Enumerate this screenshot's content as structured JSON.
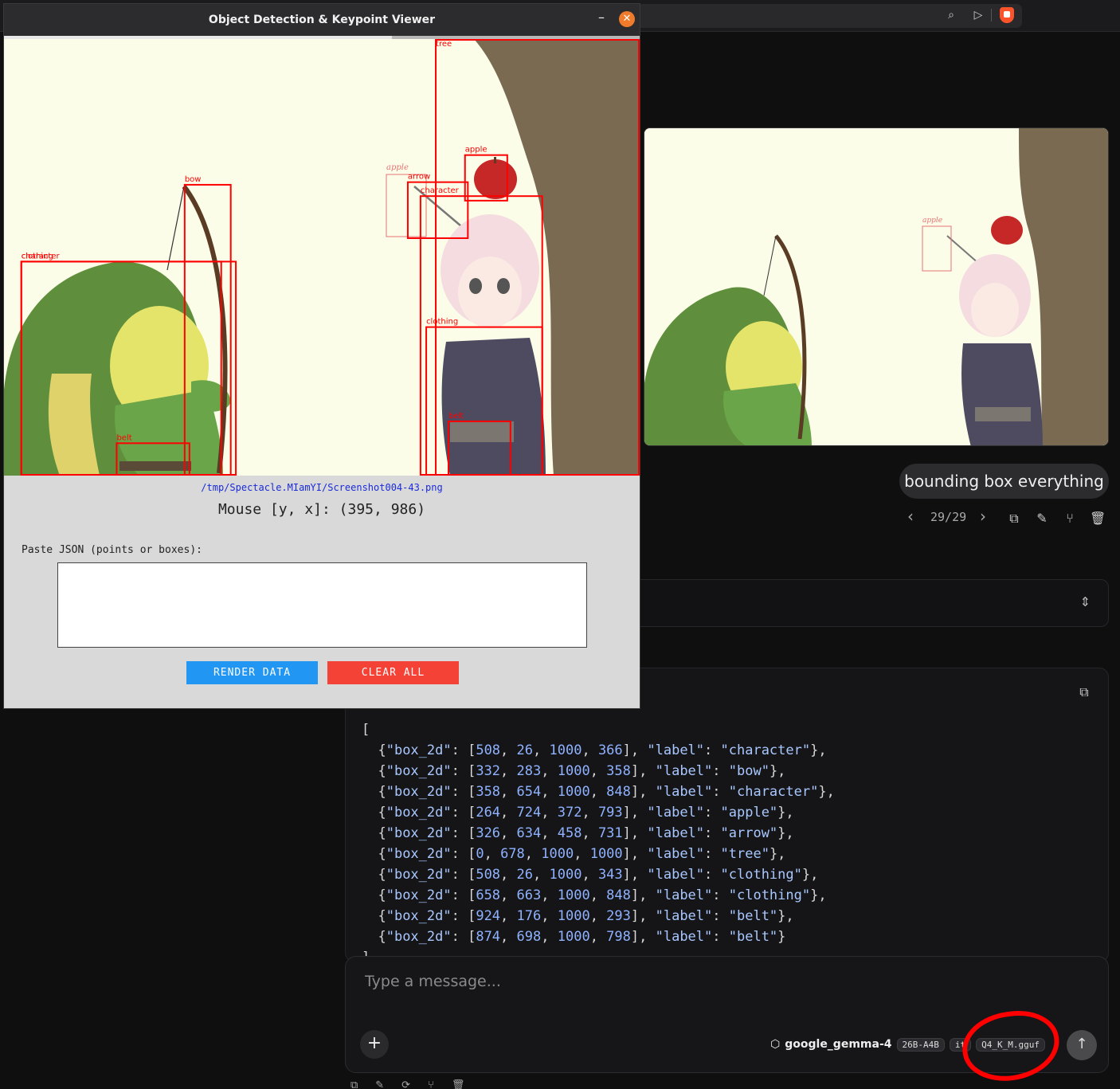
{
  "viewer": {
    "title": "Object Detection & Keypoint Viewer",
    "min_glyph": "–",
    "close_glyph": "✕",
    "progress": 0.61,
    "file_path": "/tmp/Spectacle.MIamYI/Screenshot004-43.png",
    "mouse_readout": "Mouse [y, x]: (395, 986)",
    "paste_label": "Paste JSON (points or boxes):",
    "json_input_value": "",
    "render_button": "RENDER DATA",
    "clear_button": "CLEAR ALL",
    "box_color": "#ff0000",
    "detections": [
      {
        "box_2d": [
          508,
          26,
          1000,
          366
        ],
        "label": "character"
      },
      {
        "box_2d": [
          332,
          283,
          1000,
          358
        ],
        "label": "bow"
      },
      {
        "box_2d": [
          358,
          654,
          1000,
          848
        ],
        "label": "character"
      },
      {
        "box_2d": [
          264,
          724,
          372,
          793
        ],
        "label": "apple"
      },
      {
        "box_2d": [
          326,
          634,
          458,
          731
        ],
        "label": "arrow"
      },
      {
        "box_2d": [
          0,
          678,
          1000,
          1000
        ],
        "label": "tree"
      },
      {
        "box_2d": [
          508,
          26,
          1000,
          343
        ],
        "label": "clothing"
      },
      {
        "box_2d": [
          658,
          663,
          1000,
          848
        ],
        "label": "clothing"
      },
      {
        "box_2d": [
          924,
          176,
          1000,
          293
        ],
        "label": "belt"
      },
      {
        "box_2d": [
          874,
          698,
          1000,
          798
        ],
        "label": "belt"
      }
    ],
    "faint_label": "apple"
  },
  "chat": {
    "preview_label": "apple",
    "user_message": "bounding box everything",
    "message_counter": "29/29",
    "nav_prev": "‹",
    "nav_next": "›",
    "message_actions": [
      "copy-icon",
      "edit-icon",
      "branch-icon",
      "trash-icon"
    ],
    "code_open": "[",
    "code_close": "]",
    "composer_placeholder": "Type a message...",
    "model_name": "google_gemma-4",
    "model_chips": [
      "26B-A4B",
      "it",
      "Q4_K_M.gguf"
    ],
    "send_glyph": "↑",
    "plus_glyph": "+"
  },
  "colors": {
    "render_button": "#2196f3",
    "clear_button": "#f44336",
    "annotation": "#ff0000"
  }
}
